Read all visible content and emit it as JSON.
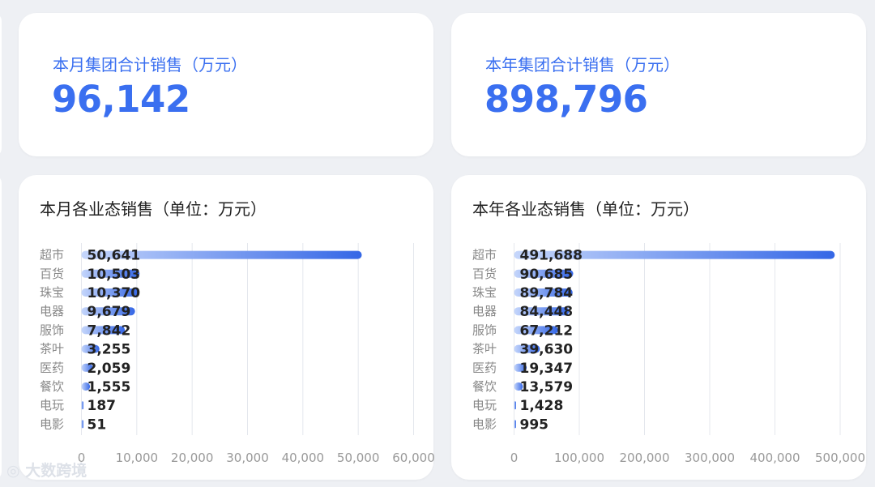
{
  "kpis": {
    "monthly": {
      "label": "本月集团合计销售（万元）",
      "value": "96,142"
    },
    "yearly": {
      "label": "本年集团合计销售（万元）",
      "value": "898,796"
    }
  },
  "colors": {
    "accent": "#3a6ff0",
    "bar_start": "#c5d6fb",
    "bar_end": "#3567e6"
  },
  "watermark": "大数跨境",
  "chart_data": [
    {
      "type": "bar",
      "orientation": "horizontal",
      "title": "本月各业态销售（单位：万元）",
      "categories": [
        "超市",
        "百货",
        "珠宝",
        "电器",
        "服饰",
        "茶叶",
        "医药",
        "餐饮",
        "电玩",
        "电影"
      ],
      "values": [
        50641,
        10503,
        10370,
        9679,
        7842,
        3255,
        2059,
        1555,
        187,
        51
      ],
      "value_labels": [
        "50,641",
        "10,503",
        "10,370",
        "9,679",
        "7,842",
        "3,255",
        "2,059",
        "1,555",
        "187",
        "51"
      ],
      "xlim": [
        0,
        60000
      ],
      "ticks": [
        0,
        10000,
        20000,
        30000,
        40000,
        50000,
        60000
      ],
      "tick_labels": [
        "0",
        "10,000",
        "20,000",
        "30,000",
        "40,000",
        "50,000",
        "60,000"
      ],
      "grid": true
    },
    {
      "type": "bar",
      "orientation": "horizontal",
      "title": "本年各业态销售（单位：万元）",
      "categories": [
        "超市",
        "百货",
        "珠宝",
        "电器",
        "服饰",
        "茶叶",
        "医药",
        "餐饮",
        "电玩",
        "电影"
      ],
      "values": [
        491688,
        90685,
        89784,
        84448,
        67212,
        39630,
        19347,
        13579,
        1428,
        995
      ],
      "value_labels": [
        "491,688",
        "90,685",
        "89,784",
        "84,448",
        "67,212",
        "39,630",
        "19,347",
        "13,579",
        "1,428",
        "995"
      ],
      "xlim": [
        0,
        500000
      ],
      "ticks": [
        0,
        100000,
        200000,
        300000,
        400000,
        500000
      ],
      "tick_labels": [
        "0",
        "100,000",
        "200,000",
        "300,000",
        "400,000",
        "500,000"
      ],
      "grid": true
    }
  ]
}
